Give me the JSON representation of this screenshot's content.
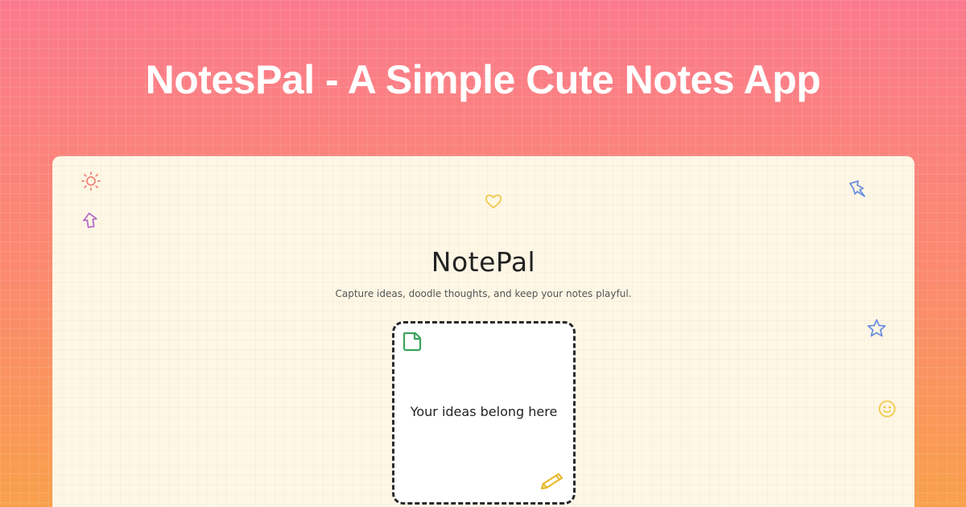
{
  "page": {
    "title": "NotesPal - A Simple Cute Notes App"
  },
  "app": {
    "name": "NotePal",
    "tagline": "Capture ideas, doodle thoughts, and keep your notes playful."
  },
  "note_card": {
    "text": "Your ideas belong here",
    "top_left_icon": "sticky-note-icon",
    "bottom_right_icon": "pencil-icon"
  },
  "doodles": [
    {
      "icon": "sun-icon",
      "color": "#f0857a"
    },
    {
      "icon": "arrow-up-icon",
      "color": "#b56cc9"
    },
    {
      "icon": "heart-icon",
      "color": "#f2c94c"
    },
    {
      "icon": "pin-icon",
      "color": "#6b8fe0"
    },
    {
      "icon": "star-icon",
      "color": "#6b8fe0"
    },
    {
      "icon": "smiley-icon",
      "color": "#f2c94c"
    }
  ],
  "colors": {
    "background_top": "#fb7a8e",
    "background_bottom": "#f9a04c",
    "card_background": "#fef7e5",
    "note_icon_green": "#3aa35c",
    "pencil_yellow": "#e9b82a"
  }
}
